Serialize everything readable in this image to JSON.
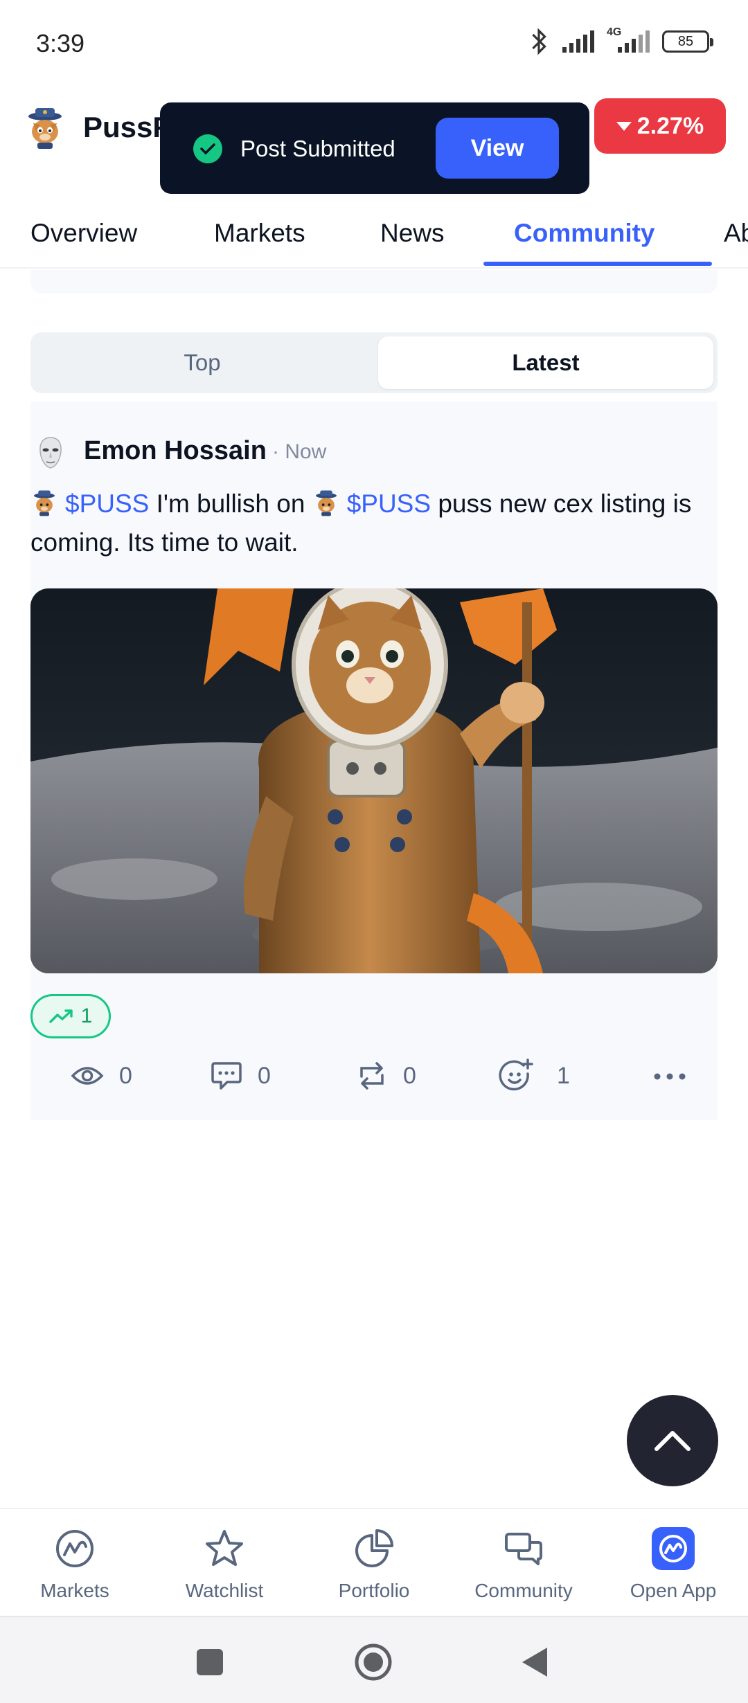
{
  "status_bar": {
    "time": "3:39",
    "network": "4G",
    "battery": "85"
  },
  "header": {
    "coin_name": "PussF",
    "price_change": "2.27%"
  },
  "toast": {
    "message": "Post Submitted",
    "action": "View"
  },
  "tabs": [
    {
      "label": "Overview"
    },
    {
      "label": "Markets"
    },
    {
      "label": "News"
    },
    {
      "label": "Community",
      "active": true
    },
    {
      "label": "Ab"
    }
  ],
  "feed_toggle": {
    "top": "Top",
    "latest": "Latest",
    "selected": "Latest"
  },
  "post": {
    "author": "Emon Hossain",
    "time": "· Now",
    "cashtag": "$PUSS",
    "text_1": "I'm bullish on",
    "text_2": "puss new cex listing is coming. Its time to wait.",
    "sentiment_count": "1",
    "views": "0",
    "comments": "0",
    "reposts": "0",
    "reactions": "1"
  },
  "bottom_nav": [
    {
      "label": "Markets",
      "icon": "markets-icon"
    },
    {
      "label": "Watchlist",
      "icon": "star-icon"
    },
    {
      "label": "Portfolio",
      "icon": "pie-chart-icon"
    },
    {
      "label": "Community",
      "icon": "chat-bubbles-icon"
    },
    {
      "label": "Open App",
      "icon": "coinmarketcap-app-icon"
    }
  ],
  "colors": {
    "accent": "#3861fb",
    "negative": "#ea3943",
    "positive": "#16c784",
    "toast_bg": "#0b1426"
  }
}
